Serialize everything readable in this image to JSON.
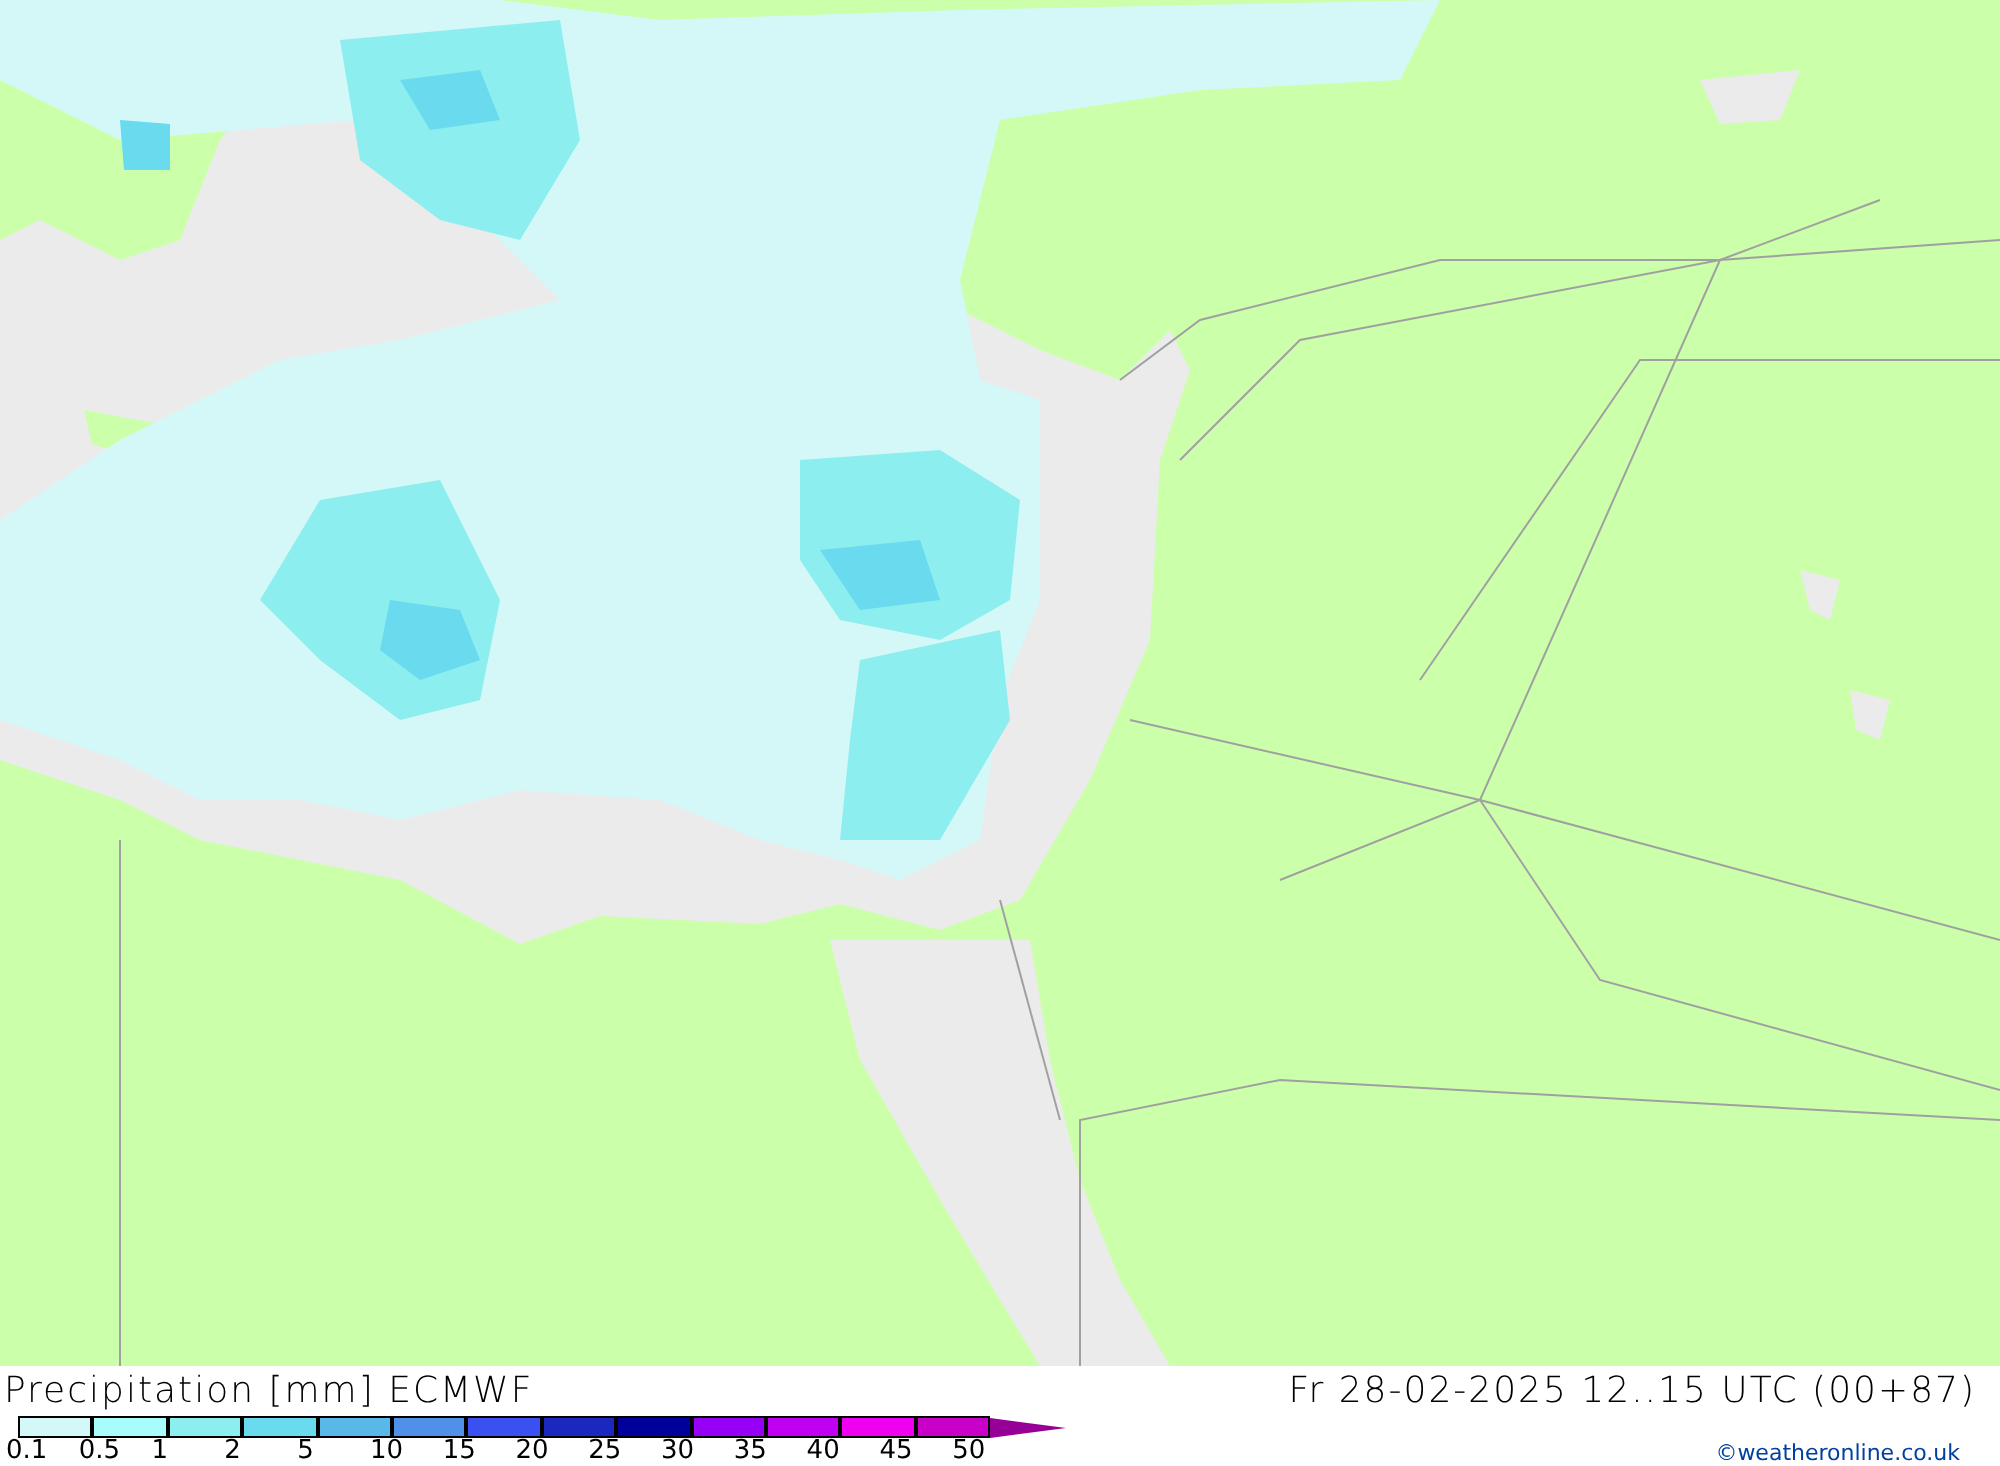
{
  "legend": {
    "title": "Precipitation [mm] ECMWF",
    "swatches": [
      {
        "color": "#d4f8f8"
      },
      {
        "color": "#a8fcfc"
      },
      {
        "color": "#8ceeee"
      },
      {
        "color": "#6adaee"
      },
      {
        "color": "#5ab8e8"
      },
      {
        "color": "#5090e8"
      },
      {
        "color": "#3a50f0"
      },
      {
        "color": "#1a28c0"
      },
      {
        "color": "#00009a"
      },
      {
        "color": "#9600f6"
      },
      {
        "color": "#c000f0"
      },
      {
        "color": "#f000f0"
      },
      {
        "color": "#c800c8"
      }
    ],
    "overflow": {
      "color": "#960096"
    },
    "ticks": [
      "0.1",
      "0.5",
      "1",
      "2",
      "5",
      "10",
      "15",
      "20",
      "25",
      "30",
      "35",
      "40",
      "45",
      "50"
    ]
  },
  "valid_time": "Fr 28-02-2025 12..15 UTC (00+87)",
  "credit": "©weatheronline.co.uk"
}
